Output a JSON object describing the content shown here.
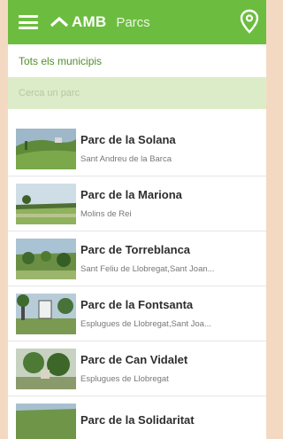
{
  "appbar": {
    "brand": "AMB",
    "title": "Parcs"
  },
  "filter": {
    "label": "Tots els municipis"
  },
  "search": {
    "placeholder": "Cerca un parc"
  },
  "parks": [
    {
      "name": "Parc de la Solana",
      "municipality": "Sant Andreu de la Barca"
    },
    {
      "name": "Parc de la Mariona",
      "municipality": "Molins de Rei"
    },
    {
      "name": "Parc de Torreblanca",
      "municipality": "Sant Feliu de Llobregat,Sant Joan..."
    },
    {
      "name": "Parc de la Fontsanta",
      "municipality": "Esplugues de Llobregat,Sant Joa..."
    },
    {
      "name": "Parc de Can Vidalet",
      "municipality": "Esplugues de Llobregat"
    },
    {
      "name": "Parc de la Solidaritat",
      "municipality": ""
    }
  ],
  "colors": {
    "accent": "#6cbd3f",
    "search_bg": "#dcecc8",
    "filter_text": "#4f8f2c"
  },
  "icons": [
    "menu-icon",
    "amb-logo-icon",
    "map-pin-icon"
  ]
}
